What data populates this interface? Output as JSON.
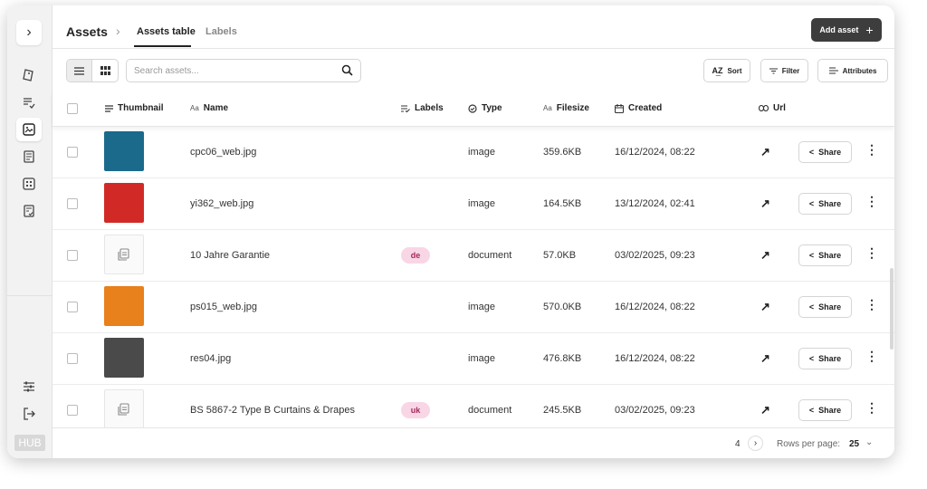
{
  "breadcrumb": {
    "root": "Assets"
  },
  "tabs": [
    {
      "label": "Assets table",
      "active": true
    },
    {
      "label": "Labels",
      "active": false
    }
  ],
  "actions": {
    "add_asset": "Add asset"
  },
  "search": {
    "placeholder": "Search assets..."
  },
  "toolbar": {
    "sort": "Sort",
    "filter": "Filter",
    "attributes": "Attributes"
  },
  "columns": {
    "thumbnail": "Thumbnail",
    "name": "Name",
    "labels": "Labels",
    "type": "Type",
    "filesize": "Filesize",
    "created": "Created",
    "url": "Url"
  },
  "share_label": "Share",
  "rows": [
    {
      "name": "cpc06_web.jpg",
      "label": "",
      "type": "image",
      "filesize": "359.6KB",
      "created": "16/12/2024, 08:22",
      "thumb": "#1b6a8c"
    },
    {
      "name": "yi362_web.jpg",
      "label": "",
      "type": "image",
      "filesize": "164.5KB",
      "created": "13/12/2024, 02:41",
      "thumb": "#d12a26"
    },
    {
      "name": "10 Jahre Garantie",
      "label": "de",
      "type": "document",
      "filesize": "57.0KB",
      "created": "03/02/2025, 09:23",
      "thumb": "doc"
    },
    {
      "name": "ps015_web.jpg",
      "label": "",
      "type": "image",
      "filesize": "570.0KB",
      "created": "16/12/2024, 08:22",
      "thumb": "#e8801c"
    },
    {
      "name": "res04.jpg",
      "label": "",
      "type": "image",
      "filesize": "476.8KB",
      "created": "16/12/2024, 08:22",
      "thumb": "#4a4a4a"
    },
    {
      "name": "BS 5867-2 Type B Curtains & Drapes",
      "label": "uk",
      "type": "document",
      "filesize": "245.5KB",
      "created": "03/02/2025, 09:23",
      "thumb": "doc"
    }
  ],
  "pagination": {
    "page": "4",
    "rows_per_page_label": "Rows per page:",
    "rows_per_page": "25"
  },
  "sidebar": {
    "hub_label": "HUB"
  },
  "colors": {
    "accent_dark": "#3d3d3d",
    "badge_bg": "#f9d6e5",
    "badge_text": "#a22a5b"
  }
}
